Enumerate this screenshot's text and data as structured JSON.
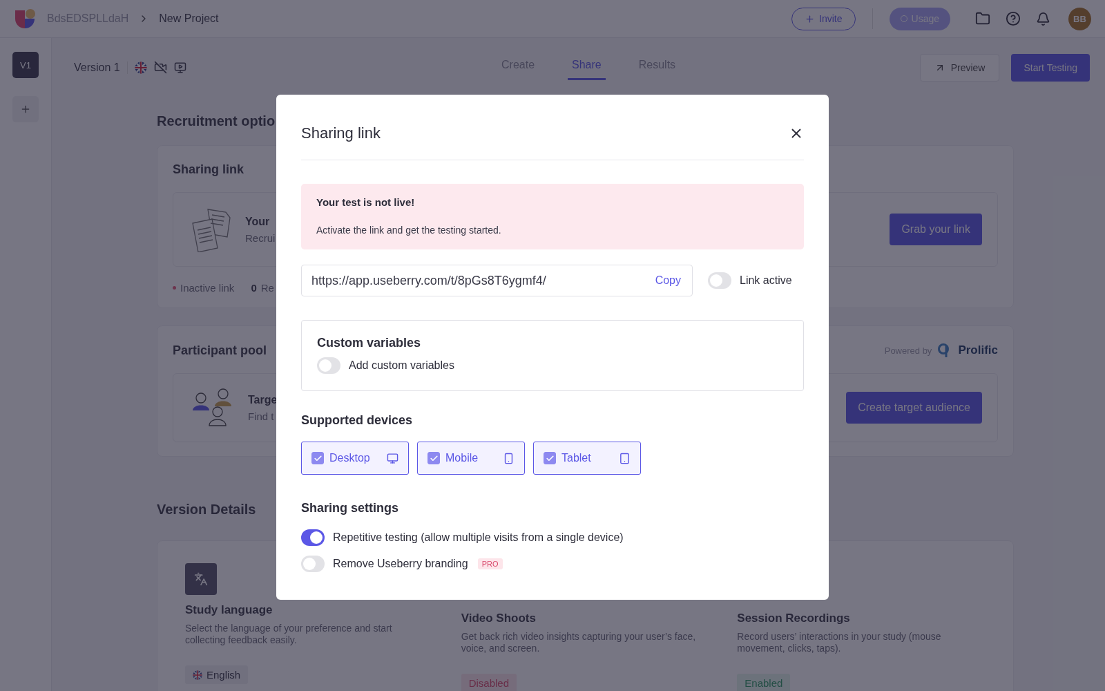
{
  "top_bar": {
    "workspace": "BdsEDSPLLdaH",
    "project": "New Project",
    "invite": "Invite",
    "usage": "Usage",
    "avatar": "BB"
  },
  "sidebar": {
    "versions": [
      {
        "label": "V1",
        "selected": true
      }
    ]
  },
  "version_bar": {
    "title": "Version 1",
    "tabs": [
      {
        "label": "Create",
        "selected": false
      },
      {
        "label": "Share",
        "selected": true
      },
      {
        "label": "Results",
        "selected": false
      }
    ],
    "preview": "Preview",
    "start": "Start Testing"
  },
  "recruitment": {
    "heading": "Recruitment optio",
    "sharing_card": {
      "title": "Sharing link",
      "item_title": "Your",
      "item_text": "Recrui",
      "button": "Grab your link",
      "status": "Inactive link",
      "count": "0",
      "count_label": "Re"
    },
    "pool_card": {
      "title": "Participant pool",
      "powered_by": "Powered by",
      "brand": "Prolific",
      "item_title": "Targe",
      "item_text": "Find t",
      "button": "Create target audience"
    }
  },
  "version_details": {
    "heading": "Version Details",
    "items": [
      {
        "kind": "language",
        "title": "Study language",
        "description": "Select the language of your preference and start collecting feedback easily.",
        "badge": "English"
      },
      {
        "kind": "video",
        "title": "Video Shoots",
        "description": "Get back rich video insights capturing your user’s face, voice, and screen.",
        "badge": "Disabled",
        "enabled": false
      },
      {
        "kind": "recording",
        "title": "Session Recordings",
        "description": "Record users’ interactions in your study (mouse movement, clicks, taps).",
        "badge": "Enabled",
        "enabled": true
      }
    ]
  },
  "modal": {
    "title": "Sharing link",
    "alert": {
      "title": "Your test is not live!",
      "text": "Activate the link and get the testing started."
    },
    "link": {
      "value": "https://app.useberry.com/t/8pGs8T6ygmf4/",
      "copy": "Copy",
      "toggle_label": "Link active",
      "on": false
    },
    "custom_variables": {
      "title": "Custom variables",
      "label": "Add custom variables",
      "on": false
    },
    "devices_heading": "Supported devices",
    "devices": [
      {
        "kind": "desktop",
        "label": "Desktop",
        "checked": true
      },
      {
        "kind": "mobile",
        "label": "Mobile",
        "checked": true
      },
      {
        "kind": "tablet",
        "label": "Tablet",
        "checked": true
      }
    ],
    "settings_heading": "Sharing settings",
    "settings": [
      {
        "label": "Repetitive testing (allow multiple visits from a single device)",
        "on": true
      },
      {
        "label": "Remove Useberry branding",
        "on": false,
        "badge": "PRO"
      }
    ]
  }
}
